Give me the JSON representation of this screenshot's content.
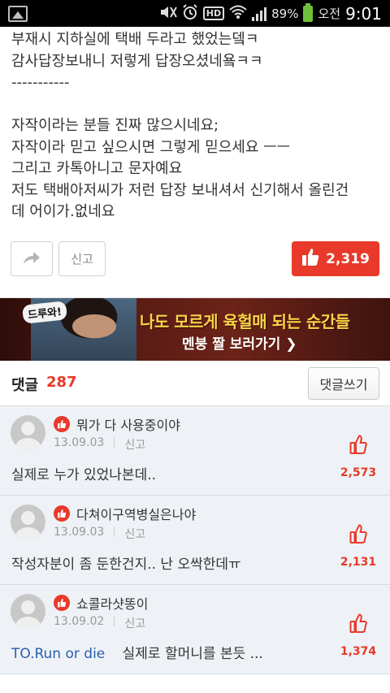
{
  "status_bar": {
    "battery": "89%",
    "ampm": "오전",
    "time": "9:01",
    "hd": "HD"
  },
  "post": {
    "lines": [
      "부재시 지하실에 택배 두라고 했었는뎈ㅋ",
      "감사답장보내니 저렇게 답장오셨네욬ㅋㅋ",
      "-----------",
      "",
      "자작이라는 분들 진짜 많으시네요;",
      "자작이라 믿고 싶으시면 그렇게 믿으세요 ㅡㅡ",
      "그리고 카톡아니고 문자예요",
      "저도 택배아저씨가 저런 답장 보내셔서 신기해서 올린건",
      "데 어이가.없네요"
    ]
  },
  "actions": {
    "report_label": "신고",
    "like_count": "2,319"
  },
  "banner": {
    "badge": "드루와!",
    "headline": "나도 모르게 육헐매 되는 순간들",
    "cta": "멘붕 짤 보러가기 ❯"
  },
  "comments": {
    "label": "댓글",
    "count": "287",
    "write_label": "댓글쓰기",
    "items": [
      {
        "nickname": "뭐가 다 사용중이야",
        "date": "13.09.03",
        "report": "신고",
        "link": "",
        "text": "실제로 누가 있었나본데..",
        "likes": "2,573"
      },
      {
        "nickname": "다쳐이구역병실은나야",
        "date": "13.09.03",
        "report": "신고",
        "link": "",
        "text": "작성자분이 좀 둔한건지.. 난 오싹한데ㅠ",
        "likes": "2,131"
      },
      {
        "nickname": "쇼콜라샷똥이",
        "date": "13.09.02",
        "report": "신고",
        "link": "TO.Run or die",
        "text": "실제로 할머니를 본듯 ...",
        "likes": "1,374"
      }
    ]
  },
  "colors": {
    "accent": "#e8392a",
    "link": "#2a5db0",
    "comment_bg": "#eef2f6"
  },
  "icons": [
    "picture-icon",
    "mute-icon",
    "alarm-icon",
    "wifi-icon",
    "signal-icon",
    "battery-icon",
    "share-icon",
    "thumbs-up-icon",
    "best-badge-icon",
    "avatar-icon"
  ]
}
